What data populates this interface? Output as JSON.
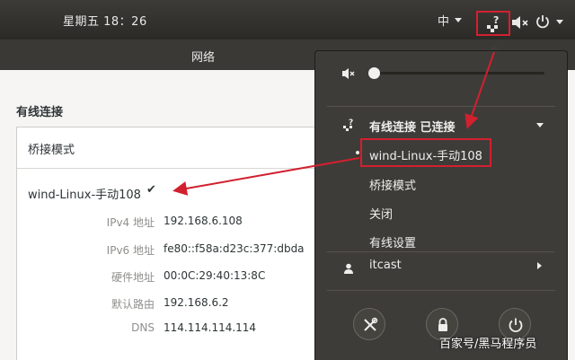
{
  "topbar": {
    "clock": "星期五 18：26",
    "input_method": "中"
  },
  "window": {
    "title": "网络",
    "section_label": "有线连接",
    "profile_header": "桥接模式",
    "connection": {
      "name": "wind-Linux-手动108",
      "check": "✔"
    },
    "details": [
      {
        "key": "IPv4 地址",
        "value": "192.168.6.108"
      },
      {
        "key": "IPv6 地址",
        "value": "fe80::f58a:d23c:377:dbda"
      },
      {
        "key": "硬件地址",
        "value": "00:0C:29:40:13:8C"
      },
      {
        "key": "默认路由",
        "value": "192.168.6.2"
      },
      {
        "key": "DNS",
        "value": "114.114.114.114"
      }
    ]
  },
  "menu": {
    "wired_header": "有线连接 已连接",
    "items": [
      {
        "label": "wind-Linux-手动108"
      },
      {
        "label": "桥接模式"
      },
      {
        "label": "关闭"
      },
      {
        "label": "有线设置"
      }
    ],
    "user": "itcast",
    "volume_level": 0.0
  },
  "watermark": "百家号/黑马程序员",
  "colors": {
    "topbar": "#2b2a27",
    "menu_bg": "#3e3c38",
    "highlight": "#d2202f",
    "window_bg": "#f6f5f4"
  },
  "icons": {
    "network": "network-wired-question-icon",
    "volume": "volume-muted-icon",
    "power": "power-icon",
    "settings": "tools-icon",
    "lock": "lock-icon",
    "user": "user-icon"
  }
}
